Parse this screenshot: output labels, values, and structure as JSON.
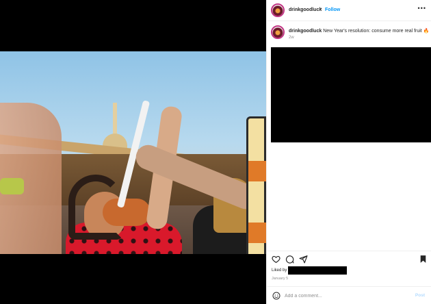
{
  "post": {
    "username": "drinkgoodluck",
    "follow_label": "Follow",
    "separator": "•",
    "more_label": "•••"
  },
  "caption": {
    "username": "drinkgoodluck",
    "text": "New Year's resolution: consume more real fruit 🔥",
    "time": "2w"
  },
  "footer": {
    "liked_by": "Liked by",
    "date": "January 5",
    "comment_placeholder": "Add a comment...",
    "post_label": "Post"
  },
  "icons": [
    "heart-icon",
    "comment-icon",
    "share-icon",
    "bookmark-icon",
    "emoji-icon",
    "more-icon"
  ],
  "colors": {
    "follow": "#0095f6",
    "post_disabled": "#b3dbff",
    "border": "#efefef",
    "muted": "#8e8e8e"
  }
}
